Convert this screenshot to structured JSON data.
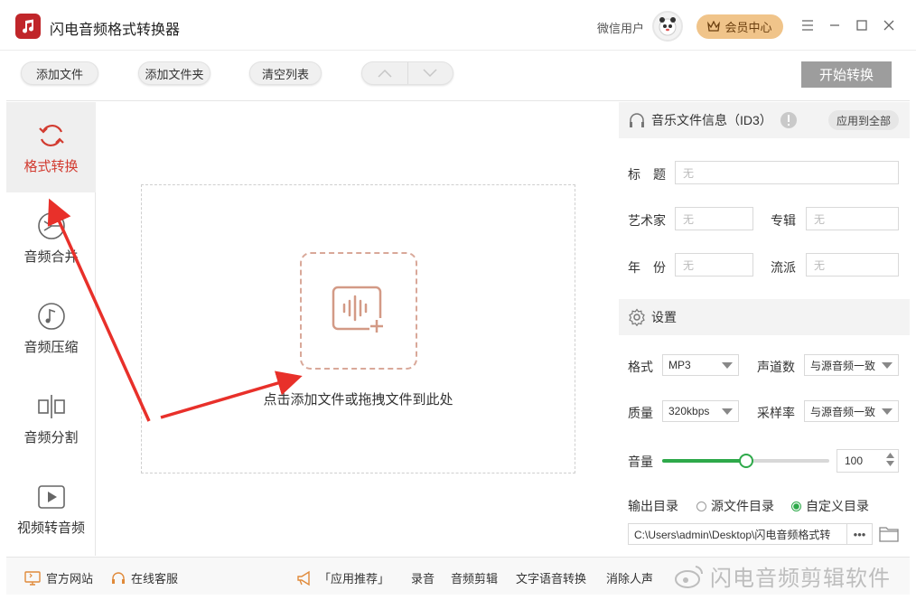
{
  "app": {
    "title": "闪电音频格式转换器",
    "user_name": "微信用户",
    "vip_label": "会员中心"
  },
  "colors": {
    "accent_red": "#d23b30",
    "accent_green": "#2ea94a",
    "vip_gold": "#f0c48a",
    "arrow_red": "#e8302a"
  },
  "toolbar": {
    "add_file": "添加文件",
    "add_folder": "添加文件夹",
    "clear_list": "清空列表",
    "start_convert": "开始转换"
  },
  "sidebar": {
    "items": [
      {
        "label": "格式转换",
        "icon": "refresh-icon",
        "active": true
      },
      {
        "label": "音频合并",
        "icon": "merge-icon",
        "active": false
      },
      {
        "label": "音频压缩",
        "icon": "music-note-icon",
        "active": false
      },
      {
        "label": "音频分割",
        "icon": "split-icon",
        "active": false
      },
      {
        "label": "视频转音频",
        "icon": "play-icon",
        "active": false
      }
    ]
  },
  "dropzone": {
    "hint": "点击添加文件或拖拽文件到此处"
  },
  "id3": {
    "heading": "音乐文件信息（ID3）",
    "apply_all": "应用到全部",
    "title_label": "标　题",
    "title_value": "无",
    "artist_label": "艺术家",
    "artist_value": "无",
    "album_label": "专辑",
    "album_value": "无",
    "year_label": "年　份",
    "year_value": "无",
    "genre_label": "流派",
    "genre_value": "无"
  },
  "settings": {
    "heading": "设置",
    "format_label": "格式",
    "format_value": "MP3",
    "channels_label": "声道数",
    "channels_value": "与源音频一致",
    "quality_label": "质量",
    "quality_value": "320kbps",
    "samplerate_label": "采样率",
    "samplerate_value": "与源音频一致",
    "volume_label": "音量",
    "volume_value": "100",
    "volume_fraction": 0.5,
    "output_label": "输出目录",
    "output_option_source": "源文件目录",
    "output_option_custom": "自定义目录",
    "output_path": "C:\\Users\\admin\\Desktop\\闪电音频格式转",
    "more_label": "•••"
  },
  "footer": {
    "website": "官方网站",
    "support": "在线客服",
    "recommend": "「应用推荐」",
    "links": [
      "录音",
      "音频剪辑",
      "文字语音转换",
      "消除人声"
    ],
    "watermark": "闪电音频剪辑软件"
  }
}
